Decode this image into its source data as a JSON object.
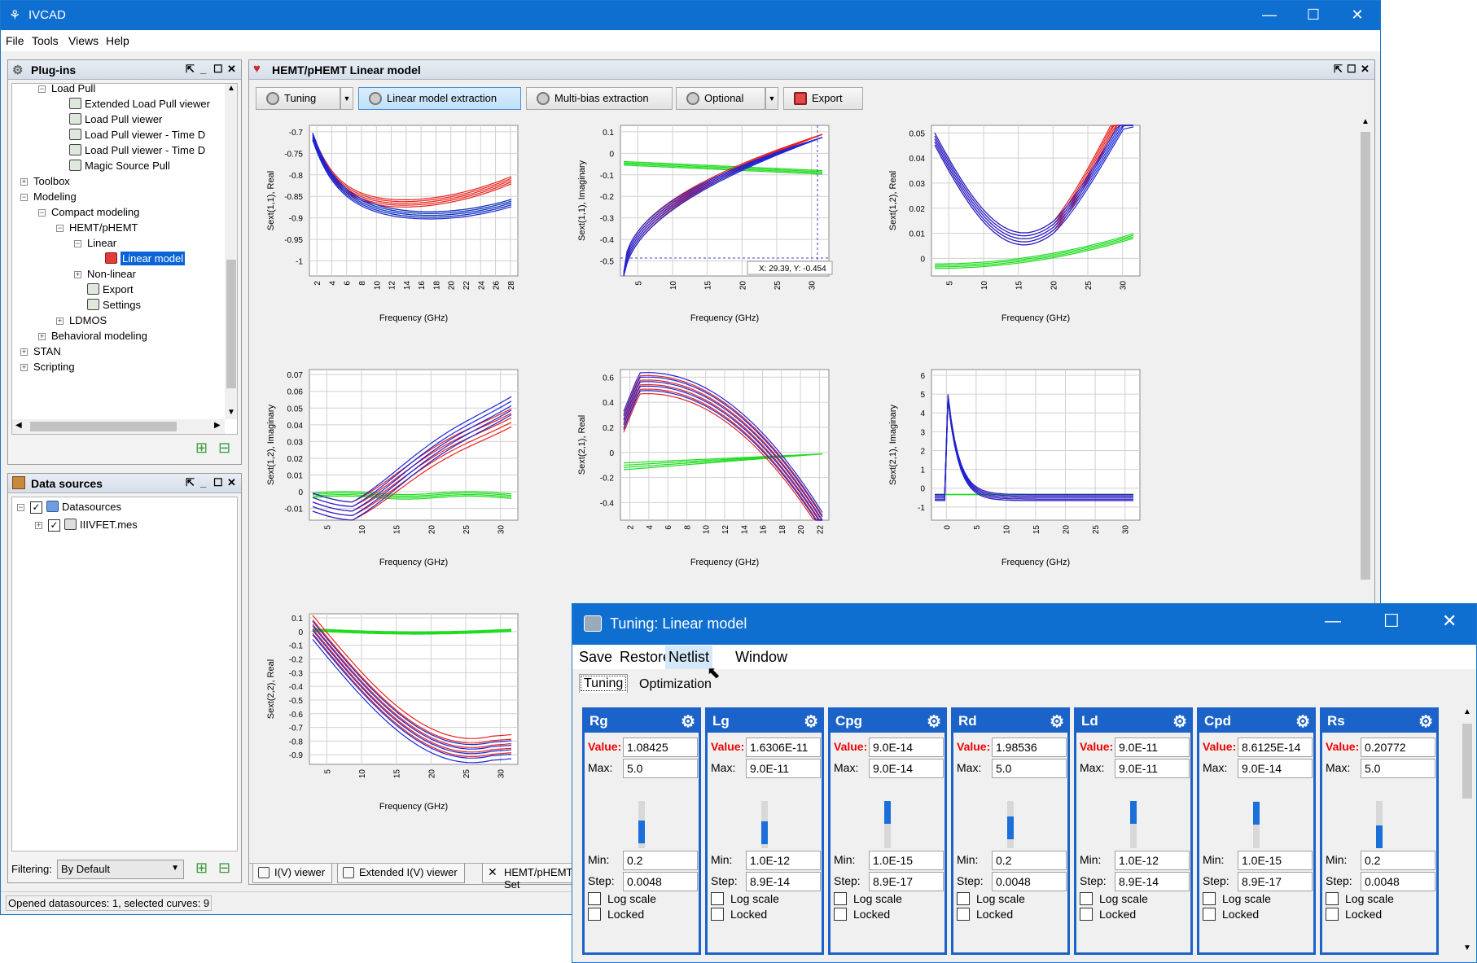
{
  "app": {
    "title": "IVCAD"
  },
  "menu": [
    "File",
    "Tools",
    "Views",
    "Help"
  ],
  "plugins": {
    "title": "Plug-ins",
    "items": [
      {
        "label": "Load Pull",
        "lvl": 2,
        "exp": "-"
      },
      {
        "label": "Extended Load Pull viewer",
        "lvl": 3
      },
      {
        "label": "Load Pull viewer",
        "lvl": 3
      },
      {
        "label": "Load Pull viewer - Time D",
        "lvl": 3
      },
      {
        "label": "Load Pull viewer - Time D",
        "lvl": 3
      },
      {
        "label": "Magic Source Pull",
        "lvl": 3
      },
      {
        "label": "Toolbox",
        "lvl": 1,
        "exp": "+"
      },
      {
        "label": "Modeling",
        "lvl": 1,
        "exp": "-"
      },
      {
        "label": "Compact modeling",
        "lvl": 2,
        "exp": "-"
      },
      {
        "label": "HEMT/pHEMT",
        "lvl": 3,
        "exp": "-"
      },
      {
        "label": "Linear",
        "lvl": 4,
        "exp": "-"
      },
      {
        "label": "Linear model",
        "lvl": 5,
        "sel": true
      },
      {
        "label": "Non-linear",
        "lvl": 4,
        "exp": "+"
      },
      {
        "label": "Export",
        "lvl": 4
      },
      {
        "label": "Settings",
        "lvl": 4
      },
      {
        "label": "LDMOS",
        "lvl": 3,
        "exp": "+"
      },
      {
        "label": "Behavioral modeling",
        "lvl": 2,
        "exp": "+"
      },
      {
        "label": "STAN",
        "lvl": 1,
        "exp": "+"
      },
      {
        "label": "Scripting",
        "lvl": 1,
        "exp": "+"
      }
    ]
  },
  "datasources": {
    "title": "Data sources",
    "items": [
      {
        "label": "Datasources"
      },
      {
        "label": "IIIVFET.mes"
      }
    ],
    "filter_label": "Filtering:",
    "filter_value": "By Default"
  },
  "status": "Opened datasources: 1, selected curves: 9",
  "doc": {
    "title": "HEMT/pHEMT Linear model",
    "toolbar": [
      "Tuning",
      "Linear model extraction",
      "Multi-bias extraction",
      "Optional",
      "Export"
    ],
    "bottom_tabs": [
      "I(V) viewer",
      "Extended I(V) viewer",
      "HEMT/pHEMT Set"
    ]
  },
  "colors": {
    "red": "#e8221e",
    "blue": "#1b25d6",
    "green": "#1fdb1f",
    "title_blue": "#0f6fd0"
  },
  "charts": [
    {
      "ylabel": "Sext(1,1), Real",
      "xlabel": "Frequency (GHz)",
      "yticks": [
        "-0.7",
        "-0.75",
        "-0.8",
        "-0.85",
        "-0.9",
        "-0.95",
        "-1"
      ],
      "xticks": [
        "2",
        "4",
        "6",
        "8",
        "10",
        "12",
        "14",
        "16",
        "18",
        "20",
        "22",
        "24",
        "26",
        "28"
      ],
      "cursor": ""
    },
    {
      "ylabel": "Sext(1,1), Imaginary",
      "xlabel": "Frequency (GHz)",
      "yticks": [
        "0.1",
        "0",
        "-0.1",
        "-0.2",
        "-0.3",
        "-0.4",
        "-0.5"
      ],
      "xticks": [
        "5",
        "10",
        "15",
        "20",
        "25",
        "30"
      ],
      "cursor": "X: 29.39,  Y: -0.454"
    },
    {
      "ylabel": "Sext(1,2), Real",
      "xlabel": "Frequency (GHz)",
      "yticks": [
        "0.05",
        "0.04",
        "0.03",
        "0.02",
        "0.01",
        "0"
      ],
      "xticks": [
        "5",
        "10",
        "15",
        "20",
        "25",
        "30"
      ],
      "cursor": ""
    },
    {
      "ylabel": "Sext(1,2), Imaginary",
      "xlabel": "Frequency (GHz)",
      "yticks": [
        "0.07",
        "0.06",
        "0.05",
        "0.04",
        "0.03",
        "0.02",
        "0.01",
        "0",
        "-0.01"
      ],
      "xticks": [
        "5",
        "10",
        "15",
        "20",
        "25",
        "30"
      ],
      "cursor": ""
    },
    {
      "ylabel": "Sext(2,1), Real",
      "xlabel": "Frequency (GHz)",
      "yticks": [
        "0.6",
        "0.4",
        "0.2",
        "0",
        "-0.2",
        "-0.4"
      ],
      "xticks": [
        "2",
        "4",
        "6",
        "8",
        "10",
        "12",
        "14",
        "16",
        "18",
        "20",
        "22"
      ],
      "cursor": ""
    },
    {
      "ylabel": "Sext(2,1), Imaginary",
      "xlabel": "Frequency (GHz)",
      "yticks": [
        "6",
        "5",
        "4",
        "3",
        "2",
        "1",
        "0",
        "-1"
      ],
      "xticks": [
        "0",
        "5",
        "10",
        "15",
        "20",
        "25",
        "30"
      ],
      "cursor": ""
    },
    {
      "ylabel": "Sext(2,2), Real",
      "xlabel": "Frequency (GHz)",
      "yticks": [
        "0.1",
        "0",
        "-0.1",
        "-0.2",
        "-0.3",
        "-0.4",
        "-0.5",
        "-0.6",
        "-0.7",
        "-0.8",
        "-0.9"
      ],
      "xticks": [
        "5",
        "10",
        "15",
        "20",
        "25",
        "30"
      ],
      "cursor": ""
    }
  ],
  "tuning": {
    "title": "Tuning: Linear model",
    "menu": [
      "Save",
      "Restore",
      "Netlist",
      "Window"
    ],
    "tabs": [
      "Tuning",
      "Optimization"
    ],
    "labels": {
      "value": "Value:",
      "max": "Max:",
      "min": "Min:",
      "step": "Step:",
      "log": "Log scale",
      "locked": "Locked"
    },
    "params": [
      {
        "name": "Rg",
        "value": "1.08425",
        "max": "5.0",
        "min": "0.2",
        "step": "0.0048",
        "level": 0.2
      },
      {
        "name": "Lg",
        "value": "1.6306E-11",
        "max": "9.0E-11",
        "min": "1.0E-12",
        "step": "8.9E-14",
        "level": 0.17
      },
      {
        "name": "Cpg",
        "value": "9.0E-14",
        "max": "9.0E-14",
        "min": "1.0E-15",
        "step": "8.9E-17",
        "level": 1.0
      },
      {
        "name": "Rd",
        "value": "1.98536",
        "max": "5.0",
        "min": "0.2",
        "step": "0.0048",
        "level": 0.37
      },
      {
        "name": "Ld",
        "value": "9.0E-11",
        "max": "9.0E-11",
        "min": "1.0E-12",
        "step": "8.9E-14",
        "level": 1.0
      },
      {
        "name": "Cpd",
        "value": "8.6125E-14",
        "max": "9.0E-14",
        "min": "1.0E-15",
        "step": "8.9E-17",
        "level": 0.96
      },
      {
        "name": "Rs",
        "value": "0.20772",
        "max": "5.0",
        "min": "0.2",
        "step": "0.0048",
        "level": 0.0
      }
    ]
  }
}
